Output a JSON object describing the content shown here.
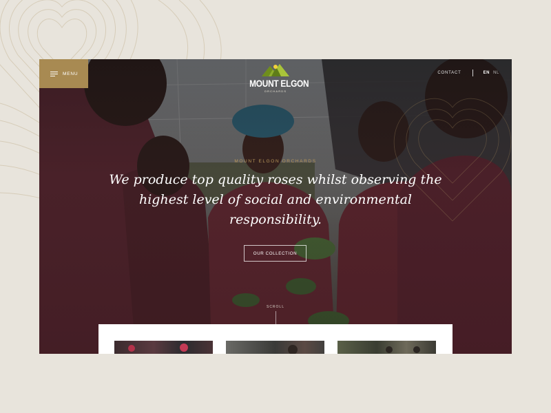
{
  "header": {
    "menu_label": "MENU",
    "logo_title": "MOUNT ELGON",
    "logo_subtitle": "ORCHARDS",
    "contact_label": "CONTACT",
    "languages": [
      {
        "code": "EN",
        "active": true
      },
      {
        "code": "NL",
        "active": false
      }
    ]
  },
  "hero": {
    "eyebrow": "MOUNT ELGON ORCHARDS",
    "headline": "We produce top quality roses whilst observing the highest level of social and environmental responsibility.",
    "cta_label": "OUR COLLECTION",
    "scroll_label": "SCROLL"
  },
  "colors": {
    "accent_gold": "#a88a52",
    "eyebrow_gold": "#b8975a",
    "page_bg": "#e8e4dc"
  },
  "icons": {
    "menu": "hamburger-icon",
    "logo": "mountain-logo-icon"
  }
}
